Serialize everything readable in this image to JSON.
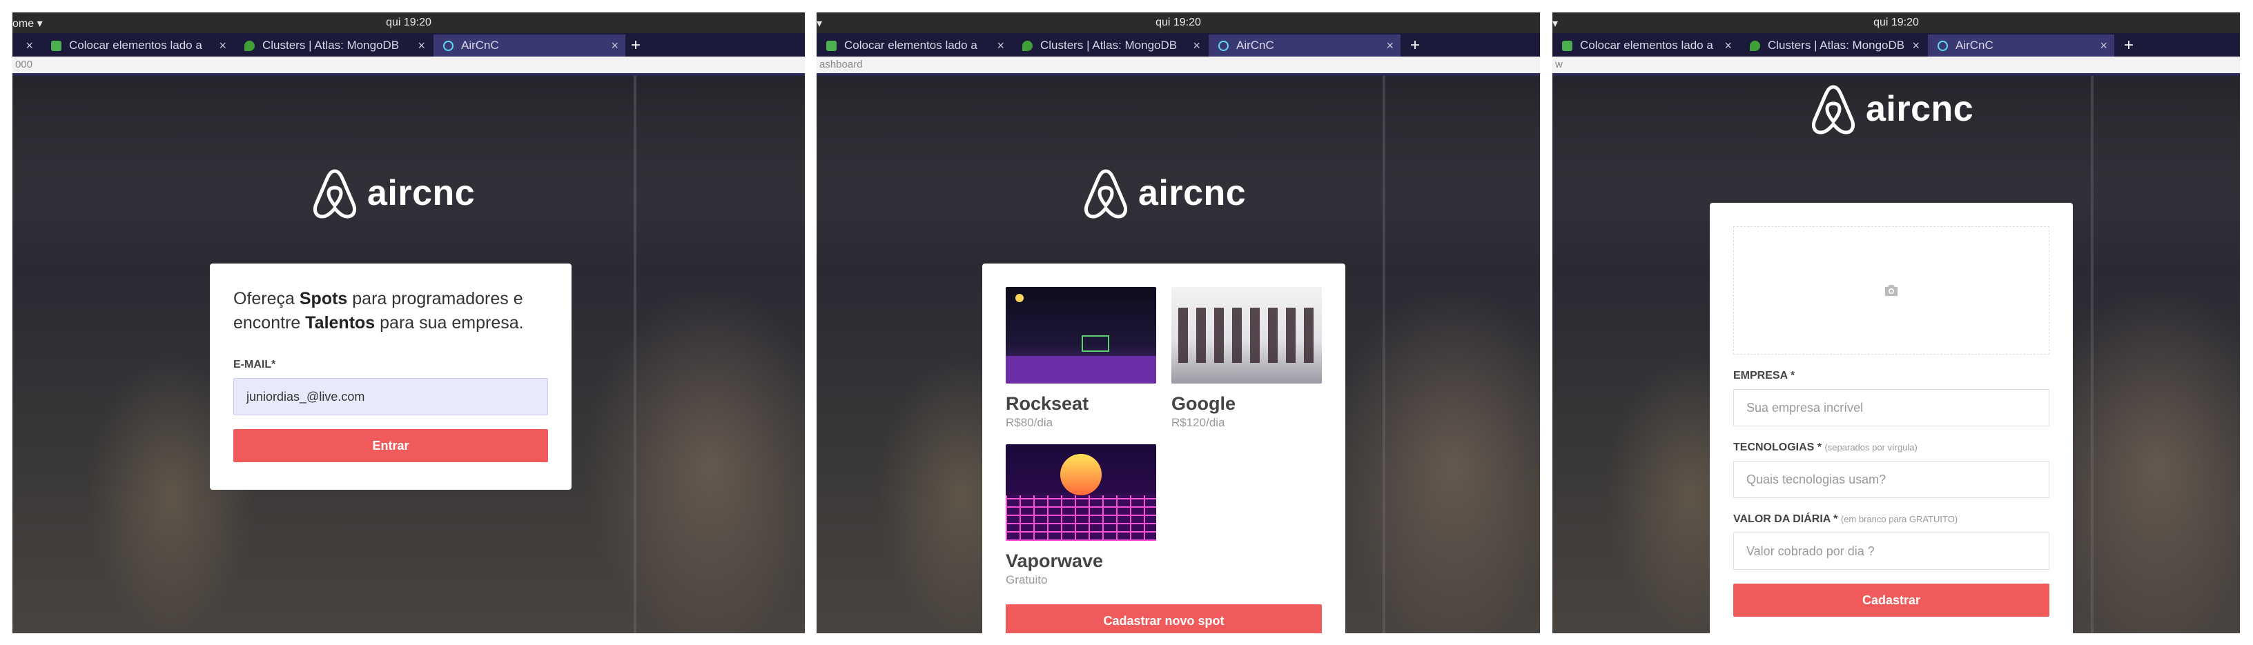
{
  "system": {
    "left_label": "ome",
    "clock": "qui 19:20"
  },
  "tabs": {
    "tab1": "Colocar elementos lado a",
    "tab2": "Clusters | Atlas: MongoDB",
    "tab3": "AirCnC",
    "close_glyph": "×",
    "new_tab": "+"
  },
  "colors": {
    "brand": "#f05a5b",
    "tabbar": "#1c1a3a",
    "active_tab": "#3a3870"
  },
  "app": {
    "wordmark": "aircnc",
    "logo_icon": "airbnb-logo-icon"
  },
  "login": {
    "url_fragment": "000",
    "headline_part1": "Ofereça ",
    "headline_bold1": "Spots",
    "headline_part2": " para programadores e encontre ",
    "headline_bold2": "Talentos",
    "headline_part3": " para sua empresa.",
    "email_label": "E-MAIL*",
    "email_value": "juniordias_@live.com",
    "submit": "Entrar"
  },
  "dashboard": {
    "url_fragment": "ashboard",
    "spots": [
      {
        "company": "Rockseat",
        "price": "R$80/dia"
      },
      {
        "company": "Google",
        "price": "R$120/dia"
      },
      {
        "company": "Vaporwave",
        "price": "Gratuito"
      }
    ],
    "new_spot_button": "Cadastrar novo spot"
  },
  "new_spot": {
    "url_fragment": "w",
    "thumbnail_icon": "camera-icon",
    "company_label": "EMPRESA *",
    "company_placeholder": "Sua empresa incrível",
    "techs_label": "TECNOLOGIAS *",
    "techs_hint": "(separados por vírgula)",
    "techs_placeholder": "Quais tecnologias usam?",
    "price_label": "VALOR DA DIÁRIA *",
    "price_hint": "(em branco para GRATUITO)",
    "price_placeholder": "Valor cobrado por dia ?",
    "submit": "Cadastrar"
  }
}
